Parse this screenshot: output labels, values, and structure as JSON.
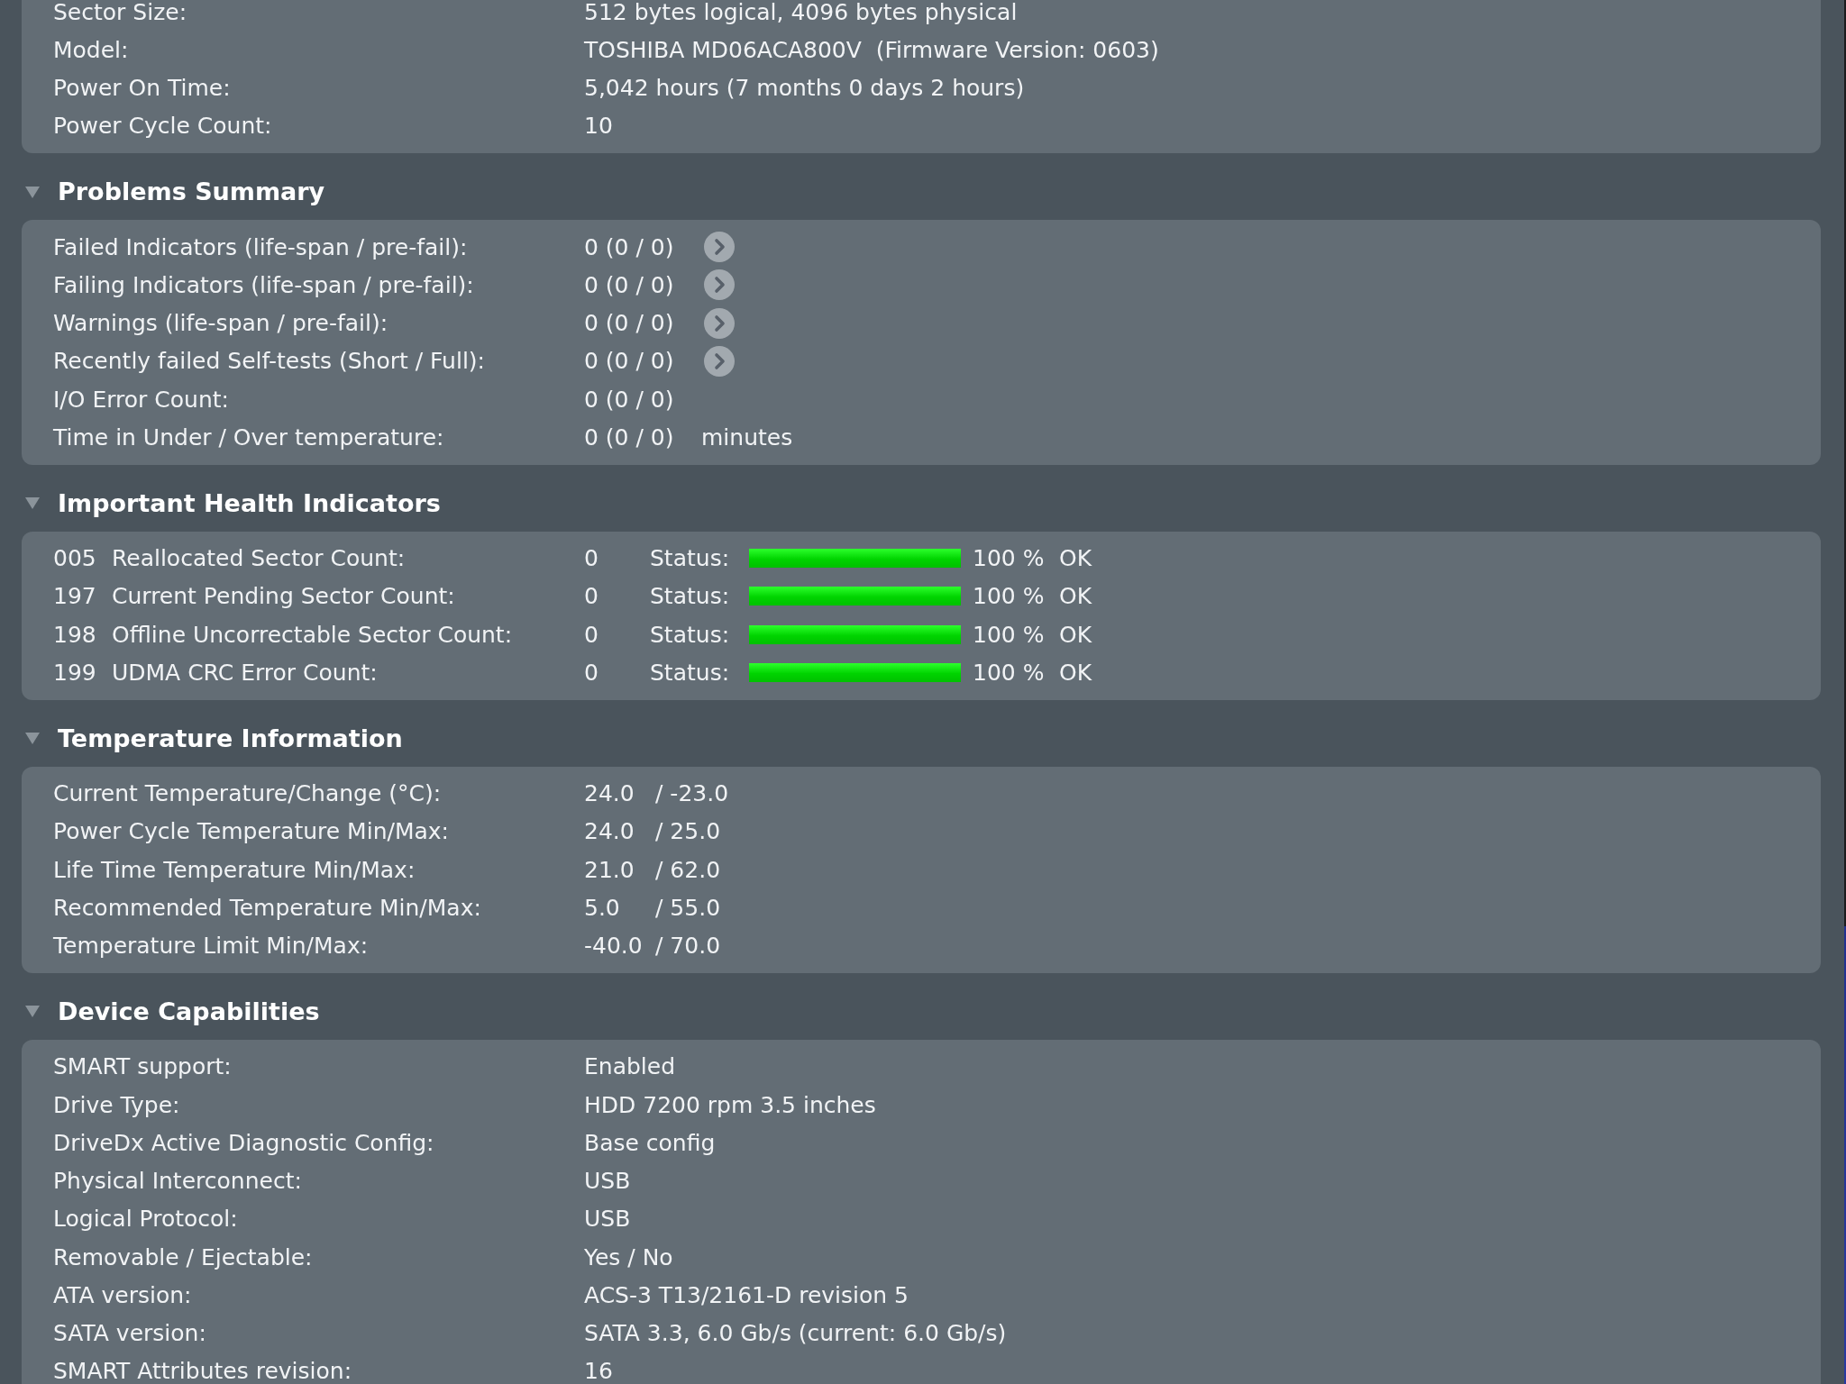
{
  "drive_info": {
    "rows": [
      {
        "label": "Sector Size:",
        "value": "512 bytes logical, 4096 bytes physical"
      },
      {
        "label": "Model:",
        "value": "TOSHIBA MD06ACA800V  (Firmware Version: 0603)"
      },
      {
        "label": "Power On Time:",
        "value": "5,042 hours (7 months 0 days 2 hours)"
      },
      {
        "label": "Power Cycle Count:",
        "value": "10"
      }
    ]
  },
  "sections": [
    {
      "kind": "problems",
      "title": "Problems Summary",
      "expanded": true,
      "rows": [
        {
          "label": "Failed Indicators (life-span / pre-fail):",
          "value": "0 (0 / 0)",
          "details": true
        },
        {
          "label": "Failing Indicators (life-span / pre-fail):",
          "value": "0 (0 / 0)",
          "details": true
        },
        {
          "label": "Warnings (life-span / pre-fail):",
          "value": "0 (0 / 0)",
          "details": true
        },
        {
          "label": "Recently failed Self-tests (Short / Full):",
          "value": "0 (0 / 0)",
          "details": true
        },
        {
          "label": "I/O Error Count:",
          "value": "0 (0 / 0)",
          "details": false
        },
        {
          "label": "Time in Under / Over temperature:",
          "value": "0 (0 / 0)",
          "details": false,
          "unit": "minutes"
        }
      ]
    },
    {
      "kind": "health",
      "title": "Important Health Indicators",
      "expanded": true,
      "rows": [
        {
          "id": "005",
          "name": "Reallocated Sector Count:",
          "value": "0",
          "status_label": "Status:",
          "level": 1,
          "percent": "100 %",
          "status": "OK"
        },
        {
          "id": "197",
          "name": "Current Pending Sector Count:",
          "value": "0",
          "status_label": "Status:",
          "level": 1,
          "percent": "100 %",
          "status": "OK"
        },
        {
          "id": "198",
          "name": "Offline Uncorrectable Sector Count:",
          "value": "0",
          "status_label": "Status:",
          "level": 1,
          "percent": "100 %",
          "status": "OK"
        },
        {
          "id": "199",
          "name": "UDMA CRC Error Count:",
          "value": "0",
          "status_label": "Status:",
          "level": 1,
          "percent": "100 %",
          "status": "OK"
        }
      ]
    },
    {
      "kind": "temperature",
      "title": "Temperature Information",
      "expanded": true,
      "rows": [
        {
          "label": "Current Temperature/Change (°C):",
          "values": [
            "24.0",
            "/ -23.0"
          ]
        },
        {
          "label": "Power Cycle Temperature Min/Max:",
          "values": [
            "24.0",
            "/ 25.0"
          ]
        },
        {
          "label": "Life Time Temperature Min/Max:",
          "values": [
            "21.0",
            "/ 62.0"
          ]
        },
        {
          "label": "Recommended Temperature Min/Max:",
          "values": [
            "5.0",
            "/ 55.0"
          ]
        },
        {
          "label": "Temperature Limit Min/Max:",
          "values": [
            "-40.0",
            "/ 70.0"
          ]
        }
      ]
    },
    {
      "kind": "info",
      "title": "Device Capabilities",
      "expanded": true,
      "rows": [
        {
          "label": "SMART support:",
          "value": "Enabled"
        },
        {
          "label": "Drive Type:",
          "value": "HDD 7200 rpm 3.5 inches"
        },
        {
          "label": "DriveDx Active Diagnostic Config:",
          "value": "Base config"
        },
        {
          "label": "Physical Interconnect:",
          "value": "USB"
        },
        {
          "label": "Logical Protocol:",
          "value": "USB"
        },
        {
          "label": "Removable / Ejectable:",
          "value": "Yes / No"
        },
        {
          "label": "ATA version:",
          "value": "ACS-3 T13/2161-D revision 5"
        },
        {
          "label": "SATA version:",
          "value": "SATA 3.3, 6.0 Gb/s (current: 6.0 Gb/s)"
        },
        {
          "label": "SMART Attributes revision:",
          "value": "16"
        }
      ]
    }
  ]
}
